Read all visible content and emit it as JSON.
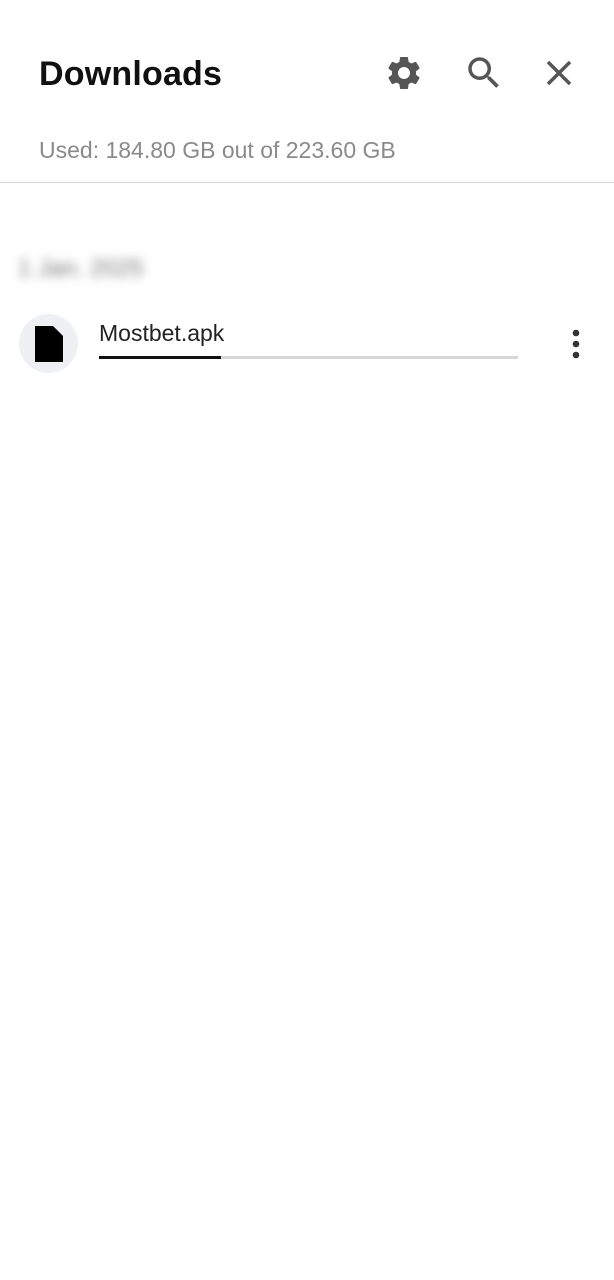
{
  "header": {
    "title": "Downloads",
    "icons": {
      "settings": "gear-icon",
      "search": "search-icon",
      "close": "close-icon"
    },
    "storage_text": "Used: 184.80 GB out of 223.60 GB"
  },
  "downloads": {
    "group_date": "1 Jan. 2025",
    "items": [
      {
        "file_name": "Mostbet.apk",
        "icon": "file-icon",
        "progress": 0.29,
        "menu_icon": "more-vert-icon"
      }
    ]
  },
  "colors": {
    "title": "#111111",
    "icon_gray": "#555555",
    "secondary_text": "#8a8a8a",
    "progress_fill": "#111111",
    "progress_track": "#d6d6d6",
    "file_icon_bg": "#eef0f3"
  }
}
